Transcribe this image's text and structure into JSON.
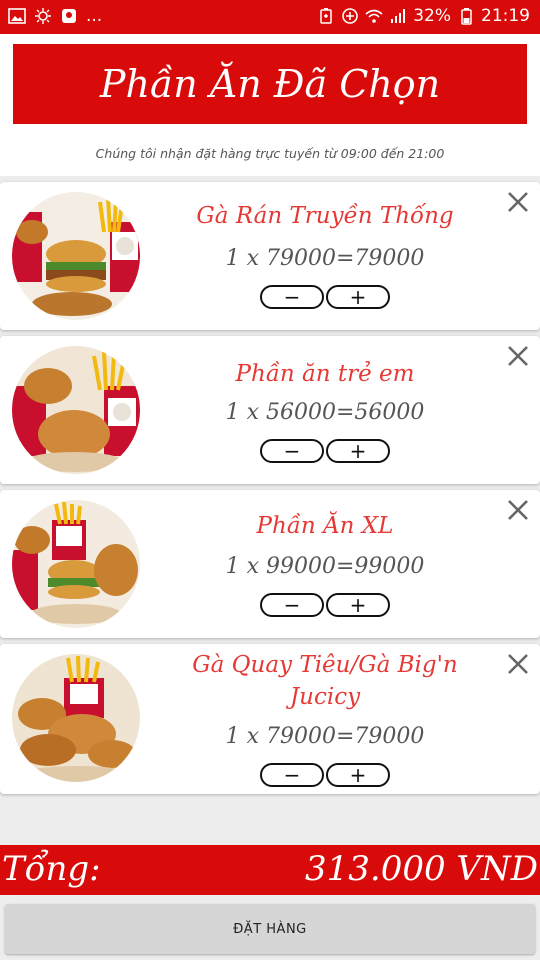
{
  "status_bar": {
    "battery": "32%",
    "time": "21:19",
    "overflow": "..."
  },
  "header": {
    "title": "Phần Ăn Đã Chọn",
    "subtitle": "Chúng tôi nhận đặt hàng trực tuyến từ 09:00 đến 21:00"
  },
  "items": [
    {
      "name": "Gà Rán Truyền Thống",
      "price_line": "1 x 79000=79000",
      "minus": "−",
      "plus": "+"
    },
    {
      "name": "Phần ăn trẻ em",
      "price_line": "1 x 56000=56000",
      "minus": "−",
      "plus": "+"
    },
    {
      "name": "Phần Ăn XL",
      "price_line": "1 x 99000=99000",
      "minus": "−",
      "plus": "+"
    },
    {
      "name": "Gà Quay Tiêu/Gà Big'n Jucicy",
      "price_line": "1 x 79000=79000",
      "minus": "−",
      "plus": "+"
    }
  ],
  "total": {
    "label": "Tổng:",
    "value": "313.000 VND"
  },
  "order_button": "ĐẶT HÀNG",
  "colors": {
    "brand_red": "#d90a0a",
    "item_name": "#e53935"
  }
}
